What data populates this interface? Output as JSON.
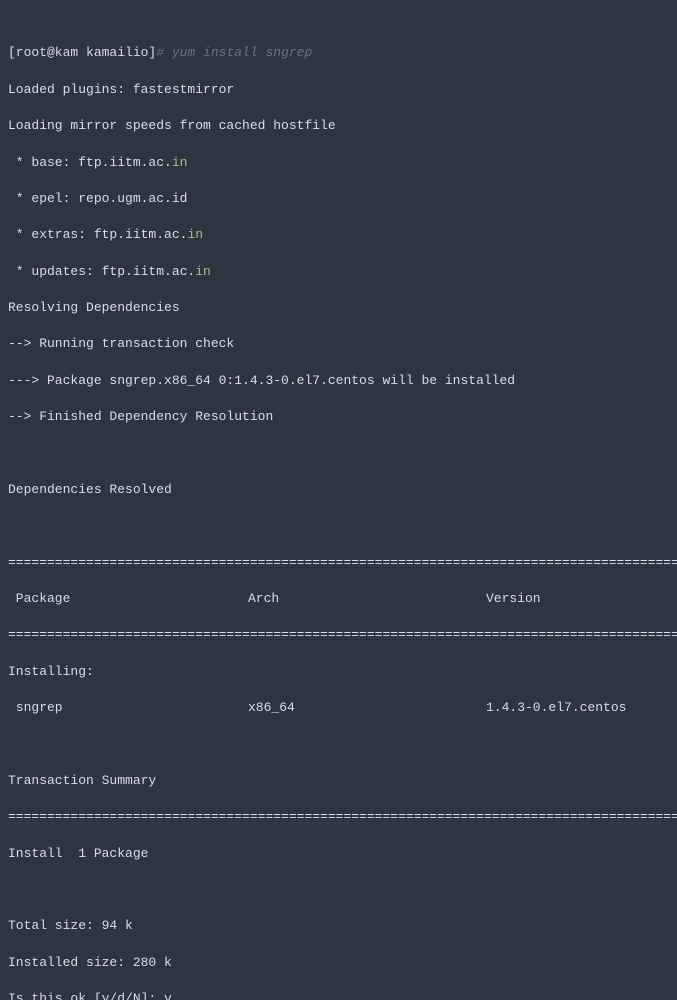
{
  "prompt": {
    "userhost": "[root@kam kamailio]",
    "hash": "#",
    "command": " yum install sngrep"
  },
  "lines": {
    "loaded_plugins": "Loaded plugins: fastestmirror",
    "loading_mirror": "Loading mirror speeds from cached hostfile",
    "base_prefix": " * base: ftp.iitm.ac.",
    "base_suffix": "in",
    "epel": " * epel: repo.ugm.ac.id",
    "extras_prefix": " * extras: ftp.iitm.ac.",
    "extras_suffix": "in",
    "updates_prefix": " * updates: ftp.iitm.ac.",
    "updates_suffix": "in",
    "resolving": "Resolving Dependencies",
    "trans_check": "--> Running transaction check",
    "pkg_install": "---> Package sngrep.x86_64 0:1.4.3-0.el7.centos will be installed",
    "finished": "--> Finished Dependency Resolution",
    "deps_resolved": "Dependencies Resolved"
  },
  "table": {
    "rule": "================================================================================================",
    "headers": {
      "package": " Package",
      "arch": "Arch",
      "version": "Version"
    },
    "installing_label": "Installing:",
    "row": {
      "package": " sngrep",
      "arch": "x86_64",
      "version": "1.4.3-0.el7.centos"
    }
  },
  "summary": {
    "title": "Transaction Summary",
    "install_line": "Install  1 Package",
    "total_size": "Total size: 94 k",
    "installed_size": "Installed size: 280 k",
    "confirm": "Is this ok [y/d/N]: y"
  }
}
